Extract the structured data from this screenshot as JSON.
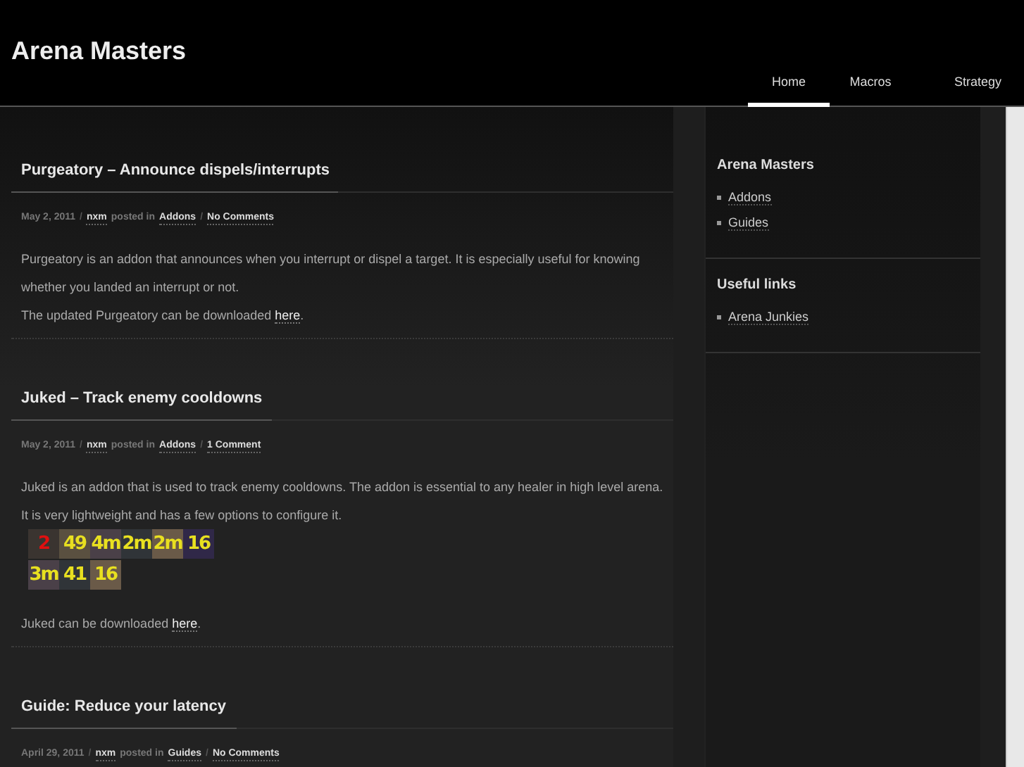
{
  "site_title": "Arena Masters",
  "nav": [
    {
      "label": "Home",
      "selected": true
    },
    {
      "label": "Macros",
      "selected": false
    },
    {
      "label": "Strategy",
      "selected": false
    }
  ],
  "posts": [
    {
      "title": "Purgeatory – Announce dispels/interrupts",
      "date": "May 2, 2011",
      "author": "nxm",
      "posted_in": "posted in",
      "category": "Addons",
      "sep": "/",
      "comments": "No Comments",
      "paragraphs": [
        {
          "kind": "text",
          "text": "Purgeatory is an addon that announces when you interrupt or dispel a target. It is especially useful for knowing whether you landed an interrupt or not."
        },
        {
          "kind": "link",
          "text": "The updated Purgeatory can be downloaded",
          "link": "here",
          "after": "."
        }
      ]
    },
    {
      "title": "Juked – Track enemy cooldowns",
      "date": "May 2, 2011",
      "author": "nxm",
      "posted_in": "posted in",
      "category": "Addons",
      "sep": "/",
      "comments": "1 Comment",
      "paragraphs": [
        {
          "kind": "text",
          "text": "Juked is an addon that is used to track enemy cooldowns. The addon is essential to any healer in high level arena. It is very lightweight and has a few options to configure it."
        },
        {
          "kind": "icons",
          "rows": [
            [
              {
                "timer": "2",
                "color": "#e01010"
              },
              {
                "timer": "49",
                "color": "#e8e020"
              },
              {
                "timer": "4m",
                "color": "#e8e020"
              },
              {
                "timer": "2m",
                "color": "#e8e020"
              },
              {
                "timer": "2m",
                "color": "#e8e020"
              },
              {
                "timer": "16",
                "color": "#e8e020"
              }
            ],
            [
              {
                "timer": "3m",
                "color": "#e8e020"
              },
              {
                "timer": "41",
                "color": "#e8e020"
              },
              {
                "timer": "16",
                "color": "#e8e020"
              }
            ]
          ]
        },
        {
          "kind": "link",
          "text": "Juked can be downloaded",
          "link": "here",
          "after": "."
        }
      ]
    },
    {
      "title": "Guide: Reduce your latency",
      "date": "April 29, 2011",
      "author": "nxm",
      "posted_in": "posted in",
      "category": "Guides",
      "sep": "/",
      "comments": "No Comments"
    }
  ],
  "sidebar": [
    {
      "heading": "Arena Masters",
      "links": [
        "Addons",
        "Guides"
      ]
    },
    {
      "heading": "Useful links",
      "links": [
        "Arena Junkies"
      ]
    }
  ]
}
